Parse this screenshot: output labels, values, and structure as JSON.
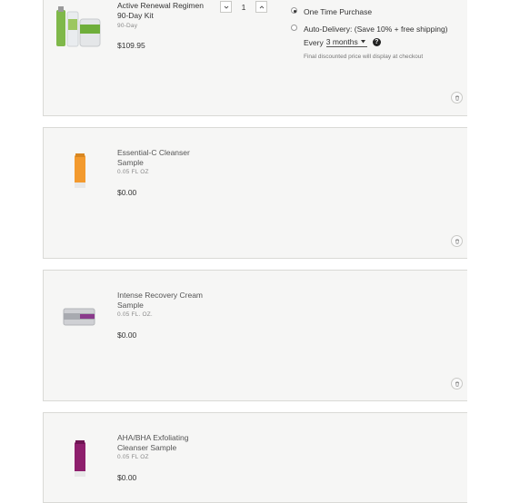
{
  "items": [
    {
      "name": "Active Renewal Regimen 90-Day Kit",
      "size": "90-Day",
      "price": "$109.95",
      "quantity": "1",
      "image_icon": "skincare-kit-image"
    },
    {
      "name": "Essential-C Cleanser Sample",
      "size": "0.05 FL OZ",
      "price": "$0.00",
      "image_icon": "orange-tube-image"
    },
    {
      "name": "Intense Recovery Cream Sample",
      "size": "0.05 FL. OZ.",
      "price": "$0.00",
      "image_icon": "cream-jar-image"
    },
    {
      "name": "AHA/BHA Exfoliating Cleanser Sample",
      "size": "0.05 FL OZ",
      "price": "$0.00",
      "image_icon": "purple-tube-image"
    }
  ],
  "purchase_options": {
    "one_time": "One Time Purchase",
    "auto_delivery": "Auto-Delivery: (Save 10% + free shipping)",
    "every_label": "Every",
    "frequency": "3 months",
    "help": "?",
    "note": "Final discounted price will display at checkout",
    "selected": "one_time"
  },
  "colors": {
    "card_bg": "#f6f6f5",
    "border": "#d9d9d6",
    "text": "#333333"
  }
}
